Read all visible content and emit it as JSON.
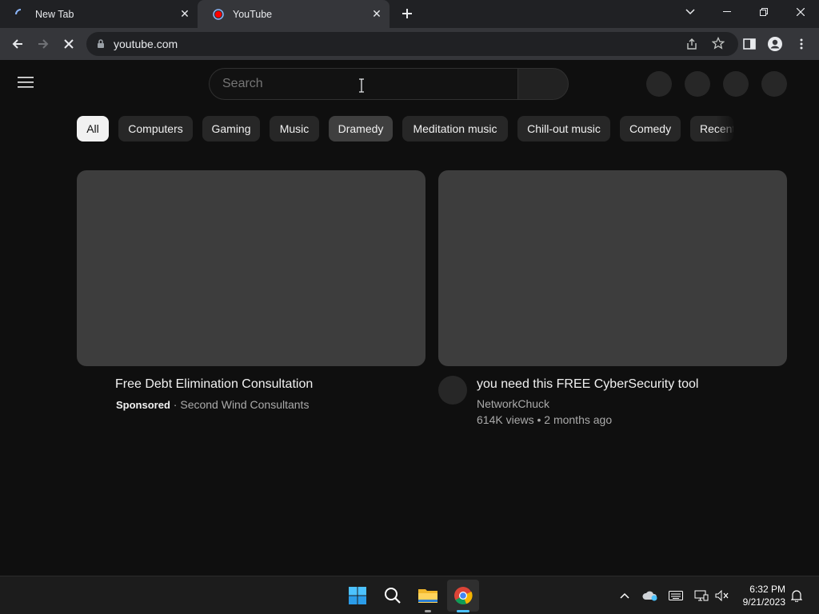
{
  "browser": {
    "tabs": [
      {
        "title": "New Tab",
        "state": "loading"
      },
      {
        "title": "YouTube",
        "state": "active"
      }
    ],
    "new_tab_icon": "plus-icon",
    "url": "youtube.com"
  },
  "youtube": {
    "search_placeholder": "Search",
    "chips": [
      "All",
      "Computers",
      "Gaming",
      "Music",
      "Dramedy",
      "Meditation music",
      "Chill-out music",
      "Comedy",
      "Recent"
    ],
    "videos": [
      {
        "title": "Free Debt Elimination Consultation",
        "sponsored_label": "Sponsored",
        "separator": "·",
        "channel": "Second Wind Consultants"
      },
      {
        "title": "you need this FREE CyberSecurity tool",
        "channel": "NetworkChuck",
        "stats": "614K views • 2 months ago"
      }
    ]
  },
  "taskbar": {
    "time": "6:32 PM",
    "date": "9/21/2023"
  },
  "colors": {
    "page_bg": "#0f0f0f",
    "chip_bg": "#272727",
    "chip_active_bg": "#f1f1f1",
    "thumb_placeholder": "#3d3d3d"
  }
}
